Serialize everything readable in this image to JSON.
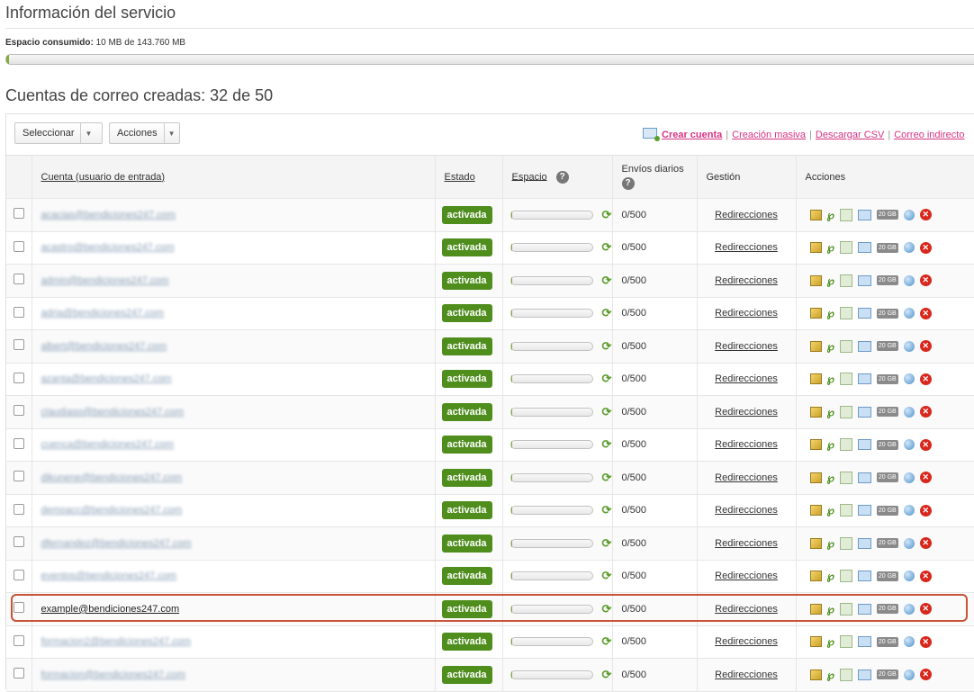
{
  "service_info": {
    "title": "Información del servicio",
    "usage_label": "Espacio consumido:",
    "usage_value": "10 MB de 143.760 MB",
    "usage_fraction": 0.0001
  },
  "accounts": {
    "title": "Cuentas de correo creadas: 32 de 50",
    "toolbar": {
      "select_label": "Seleccionar",
      "actions_label": "Acciones",
      "create_account": "Crear cuenta",
      "bulk_create": "Creación masiva",
      "download_csv": "Descargar CSV",
      "indirect_mail": "Correo indirecto"
    },
    "columns": {
      "account": "Cuenta (usuario de entrada)",
      "status": "Estado",
      "space": "Espacio",
      "daily": "Envíos diarios",
      "management": "Gestión",
      "actions": "Acciones"
    },
    "icons": {
      "help": "?",
      "refresh": "⟳",
      "storage_badge": "20 GB",
      "delete": "✕"
    },
    "rows": [
      {
        "account": "acacias@bendiciones247.com",
        "status": "activada",
        "daily": "0/500",
        "management": "Redirecciones",
        "space_fraction": 0.01
      },
      {
        "account": "acastro@bendiciones247.com",
        "status": "activada",
        "daily": "0/500",
        "management": "Redirecciones",
        "space_fraction": 0.01
      },
      {
        "account": "admin@bendiciones247.com",
        "status": "activada",
        "daily": "0/500",
        "management": "Redirecciones",
        "space_fraction": 0.01
      },
      {
        "account": "adria@bendiciones247.com",
        "status": "activada",
        "daily": "0/500",
        "management": "Redirecciones",
        "space_fraction": 0.01
      },
      {
        "account": "albert@bendiciones247.com",
        "status": "activada",
        "daily": "0/500",
        "management": "Redirecciones",
        "space_fraction": 0.01
      },
      {
        "account": "azanta@bendiciones247.com",
        "status": "activada",
        "daily": "0/500",
        "management": "Redirecciones",
        "space_fraction": 0.01
      },
      {
        "account": "claudiaso@bendiciones247.com",
        "status": "activada",
        "daily": "0/500",
        "management": "Redirecciones",
        "space_fraction": 0.01
      },
      {
        "account": "cuenca@bendiciones247.com",
        "status": "activada",
        "daily": "0/500",
        "management": "Redirecciones",
        "space_fraction": 0.01
      },
      {
        "account": "dikunene@bendiciones247.com",
        "status": "activada",
        "daily": "0/500",
        "management": "Redirecciones",
        "space_fraction": 0.01
      },
      {
        "account": "demoacc@bendiciones247.com",
        "status": "activada",
        "daily": "0/500",
        "management": "Redirecciones",
        "space_fraction": 0.01
      },
      {
        "account": "dfernandez@bendiciones247.com",
        "status": "activada",
        "daily": "0/500",
        "management": "Redirecciones",
        "space_fraction": 0.01
      },
      {
        "account": "eventos@bendiciones247.com",
        "status": "activada",
        "daily": "0/500",
        "management": "Redirecciones",
        "space_fraction": 0.01
      },
      {
        "account": "example@bendiciones247.com",
        "status": "activada",
        "daily": "0/500",
        "management": "Redirecciones",
        "space_fraction": 0.01,
        "highlighted": true
      },
      {
        "account": "formacion2@bendiciones247.com",
        "status": "activada",
        "daily": "0/500",
        "management": "Redirecciones",
        "space_fraction": 0.01
      },
      {
        "account": "formacion@bendiciones247.com",
        "status": "activada",
        "daily": "0/500",
        "management": "Redirecciones",
        "space_fraction": 0.01
      }
    ]
  },
  "colors": {
    "accent_link": "#d63384",
    "status_green": "#4f8e1d",
    "highlight_border": "#c75338"
  }
}
